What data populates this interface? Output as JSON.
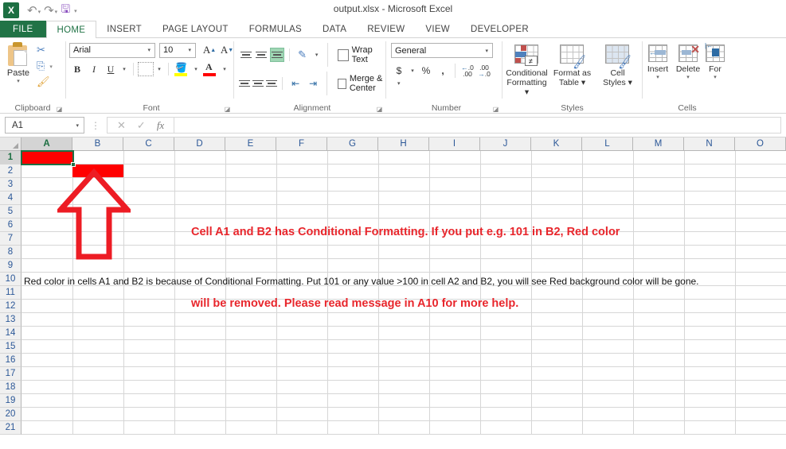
{
  "window": {
    "title": "output.xlsx - Microsoft Excel",
    "app_logo": "excel-logo"
  },
  "quick_access": {
    "undo_label": "↶",
    "redo_label": "↷",
    "save_label": "💾",
    "customize_label": "▾"
  },
  "tabs": [
    {
      "label": "FILE",
      "active": false,
      "file": true
    },
    {
      "label": "HOME",
      "active": true
    },
    {
      "label": "INSERT",
      "active": false
    },
    {
      "label": "PAGE LAYOUT",
      "active": false
    },
    {
      "label": "FORMULAS",
      "active": false
    },
    {
      "label": "DATA",
      "active": false
    },
    {
      "label": "REVIEW",
      "active": false
    },
    {
      "label": "VIEW",
      "active": false
    },
    {
      "label": "DEVELOPER",
      "active": false
    }
  ],
  "ribbon": {
    "clipboard": {
      "group_label": "Clipboard",
      "paste_label": "Paste",
      "cut_label": "✂",
      "copy_label": "⎘",
      "format_painter_label": "🖌",
      "dropdown_caret": "▾"
    },
    "font": {
      "group_label": "Font",
      "font_name": "Arial",
      "font_size": "10",
      "grow_font_label": "A",
      "shrink_font_label": "A",
      "bold_label": "B",
      "italic_label": "I",
      "underline_label": "U",
      "borders_label": "borders",
      "fill_color_label": "fill",
      "font_color_label": "A",
      "fill_color_hex": "#FFFF00",
      "font_color_hex": "#FF0000"
    },
    "alignment": {
      "group_label": "Alignment",
      "wrap_text_label": "Wrap Text",
      "merge_center_label": "Merge & Center",
      "orientation_label": "orientation",
      "decrease_indent_label": "⇤",
      "increase_indent_label": "⇥",
      "dropdown_caret": "▾"
    },
    "number": {
      "group_label": "Number",
      "format_value": "General",
      "currency_label": "$",
      "percent_label": "%",
      "comma_label": ",",
      "increase_decimal_label": ".00",
      "decrease_decimal_label": ".00"
    },
    "styles": {
      "group_label": "Styles",
      "items": [
        {
          "line1": "Conditional",
          "line2": "Formatting ▾",
          "icon": "conditional-formatting-icon"
        },
        {
          "line1": "Format as",
          "line2": "Table ▾",
          "icon": "format-as-table-icon"
        },
        {
          "line1": "Cell",
          "line2": "Styles ▾",
          "icon": "cell-styles-icon"
        }
      ]
    },
    "cells": {
      "group_label": "Cells",
      "items": [
        {
          "label": "Insert",
          "caret": "▾",
          "icon": "insert-cells-icon"
        },
        {
          "label": "Delete",
          "caret": "▾",
          "icon": "delete-cells-icon"
        },
        {
          "label": "For",
          "caret": "▾",
          "icon": "format-cells-icon"
        }
      ]
    }
  },
  "formula_bar": {
    "name_box_value": "A1",
    "name_box_caret": "▾",
    "cancel_label": "✕",
    "enter_label": "✓",
    "function_label": "fx",
    "formula_value": "",
    "divider": "⋮"
  },
  "grid": {
    "columns": [
      "A",
      "B",
      "C",
      "D",
      "E",
      "F",
      "G",
      "H",
      "I",
      "J",
      "K",
      "L",
      "M",
      "N",
      "O"
    ],
    "selected_column": "A",
    "rows": [
      "1",
      "2",
      "3",
      "4",
      "5",
      "6",
      "7",
      "8",
      "9",
      "10",
      "11",
      "12",
      "13",
      "14",
      "15",
      "16",
      "17",
      "18",
      "19",
      "20",
      "21"
    ],
    "selected_row": "1",
    "selected_cell": "A1",
    "conditional_fill_hex": "#FF0000",
    "selection_border_hex": "#1D7044",
    "filled_cells": [
      {
        "ref": "A1",
        "fill": "#FF0000"
      },
      {
        "ref": "B2",
        "fill": "#FF0000"
      }
    ],
    "annotation": {
      "shape": "up-arrow",
      "color": "#ED1C24"
    },
    "message_lines": [
      "Cell A1 and B2 has Conditional Formatting. If you put e.g. 101 in B2, Red color",
      "will be removed. Please read message in A10 for more help."
    ],
    "message_color": "#E8262C",
    "a10_text": "Red color in cells A1 and B2 is because of Conditional Formatting. Put 101 or any value >100 in cell A2 and B2, you will see Red background color will be gone."
  }
}
